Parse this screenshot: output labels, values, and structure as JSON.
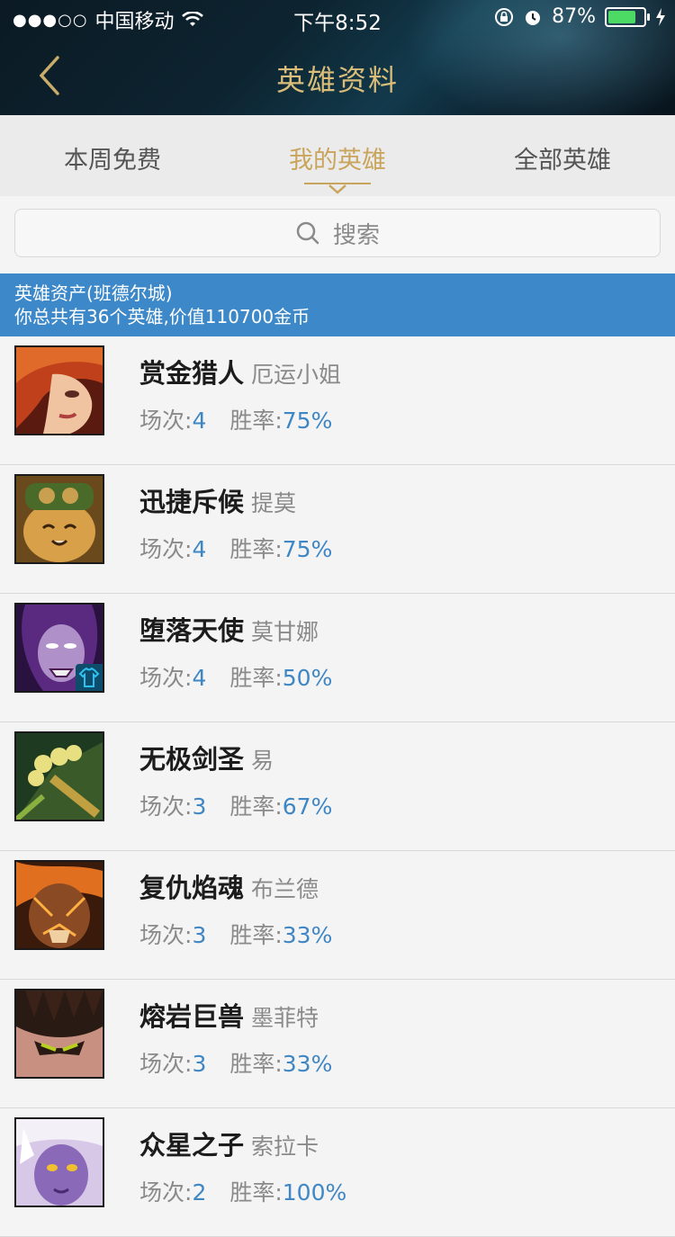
{
  "status_bar": {
    "signal_dots": "●●●○○",
    "carrier": "中国移动",
    "time": "下午8:52",
    "battery_percent": "87%",
    "battery_level": 0.87,
    "icons": [
      "wifi-icon",
      "rotation-lock-icon",
      "alarm-icon",
      "battery-icon",
      "charging-icon"
    ]
  },
  "header": {
    "title": "英雄资料",
    "back_icon": "chevron-left-icon"
  },
  "tabs": [
    {
      "label": "本周免费",
      "active": false
    },
    {
      "label": "我的英雄",
      "active": true
    },
    {
      "label": "全部英雄",
      "active": false
    }
  ],
  "search": {
    "placeholder": "搜索",
    "icon": "search-icon"
  },
  "banner": {
    "line1": "英雄资产(班德尔城)",
    "line2": "你总共有36个英雄,价值110700金币"
  },
  "stat_labels": {
    "games": "场次:",
    "winrate": "胜率:"
  },
  "heroes": [
    {
      "title": "赏金猎人",
      "name": "厄运小姐",
      "games": "4",
      "winrate": "75%"
    },
    {
      "title": "迅捷斥候",
      "name": "提莫",
      "games": "4",
      "winrate": "75%"
    },
    {
      "title": "堕落天使",
      "name": "莫甘娜",
      "games": "4",
      "winrate": "50%"
    },
    {
      "title": "无极剑圣",
      "name": "易",
      "games": "3",
      "winrate": "67%"
    },
    {
      "title": "复仇焰魂",
      "name": "布兰德",
      "games": "3",
      "winrate": "33%"
    },
    {
      "title": "熔岩巨兽",
      "name": "墨菲特",
      "games": "3",
      "winrate": "33%"
    },
    {
      "title": "众星之子",
      "name": "索拉卡",
      "games": "2",
      "winrate": "100%"
    }
  ],
  "colors": {
    "accent_gold": "#c9a45c",
    "banner_blue": "#3d88c9",
    "stat_blue": "#3f86c4"
  }
}
